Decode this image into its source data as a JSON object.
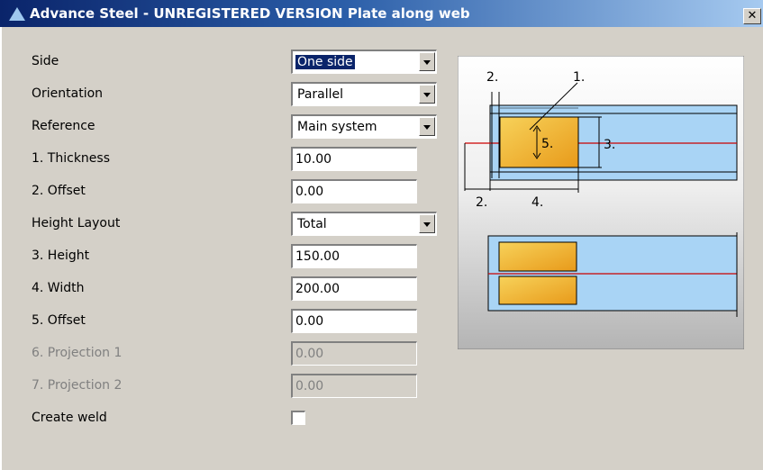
{
  "window": {
    "title": "Advance Steel - UNREGISTERED VERSION",
    "subtitle": "Plate along web",
    "close_glyph": "✕"
  },
  "form": {
    "side": {
      "label": "Side",
      "value": "One side"
    },
    "orientation": {
      "label": "Orientation",
      "value": "Parallel"
    },
    "reference": {
      "label": "Reference",
      "value": "Main system"
    },
    "thickness": {
      "label": "1. Thickness",
      "value": "10.00"
    },
    "offset2": {
      "label": "2. Offset",
      "value": "0.00"
    },
    "height_layout": {
      "label": "Height Layout",
      "value": "Total"
    },
    "height": {
      "label": "3. Height",
      "value": "150.00"
    },
    "width": {
      "label": "4. Width",
      "value": "200.00"
    },
    "offset5": {
      "label": "5. Offset",
      "value": "0.00"
    },
    "projection1": {
      "label": "6. Projection 1",
      "value": "0.00"
    },
    "projection2": {
      "label": "7. Projection 2",
      "value": "0.00"
    },
    "create_weld": {
      "label": "Create weld",
      "checked": false
    }
  },
  "diagram": {
    "labels": {
      "d1": "1.",
      "d2": "2.",
      "d3": "3.",
      "d4": "4.",
      "d5": "5."
    }
  }
}
